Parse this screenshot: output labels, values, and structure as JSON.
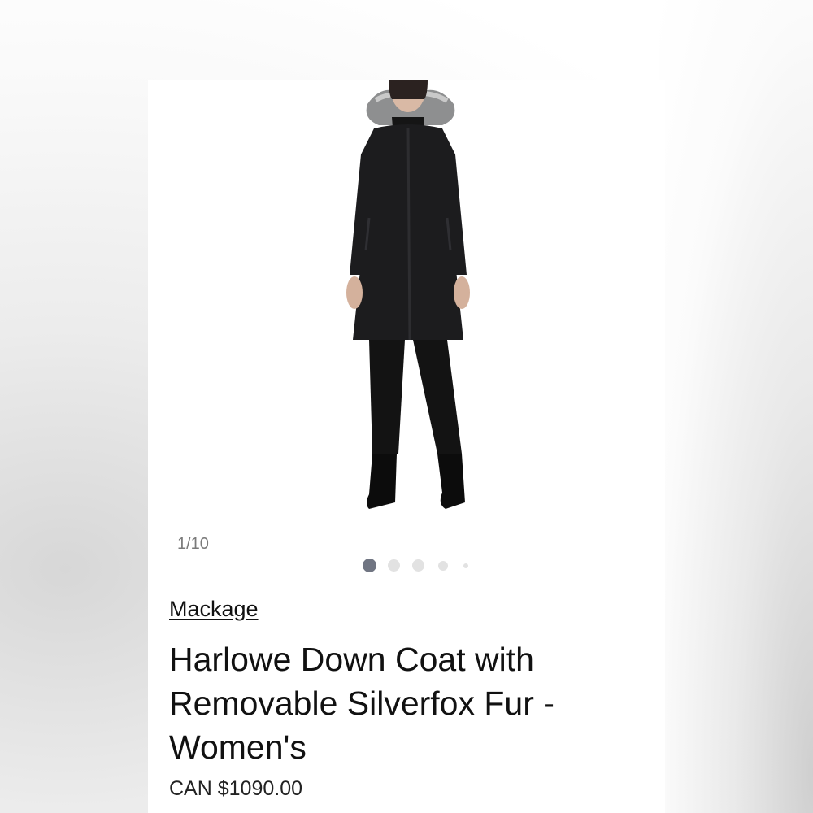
{
  "product": {
    "image_alt": "Woman wearing black down parka with grey fur-trimmed hood",
    "image_counter": "1/10",
    "carousel": {
      "dots": 5,
      "active_index": 0
    },
    "brand": "Mackage",
    "title": "Harlowe Down Coat with Removable Silverfox Fur - Women's",
    "price": "CAN $1090.00"
  },
  "colors": {
    "dot_active": "#707582",
    "dot_inactive": "#e2e2e2",
    "text": "#111111",
    "coat": "#1c1c1e"
  }
}
